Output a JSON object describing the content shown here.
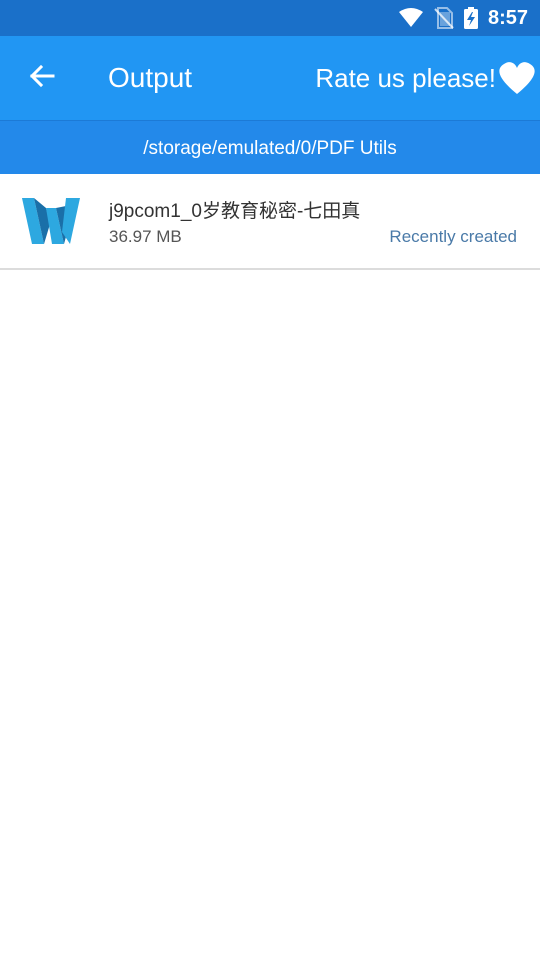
{
  "status_bar": {
    "time": "8:57",
    "icons": [
      "wifi-icon",
      "no-sim-icon",
      "battery-charging-icon"
    ]
  },
  "app_bar": {
    "back_icon": "arrow-left-icon",
    "title": "Output",
    "rate_label": "Rate us please!",
    "rate_icon": "heart-icon"
  },
  "path_bar": {
    "path": "/storage/emulated/0/PDF Utils"
  },
  "files": [
    {
      "icon": "word-document-icon",
      "name": "j9pcom1_0岁教育秘密-七田真",
      "size": "36.97 MB",
      "status": "Recently created"
    }
  ],
  "colors": {
    "status_bar": "#1a70c9",
    "app_bar": "#2196f3",
    "path_bar": "#2389ea",
    "status_text": "#4a7aa8",
    "word_icon_light": "#2da8e0",
    "word_icon_dark": "#1a6fa8"
  }
}
